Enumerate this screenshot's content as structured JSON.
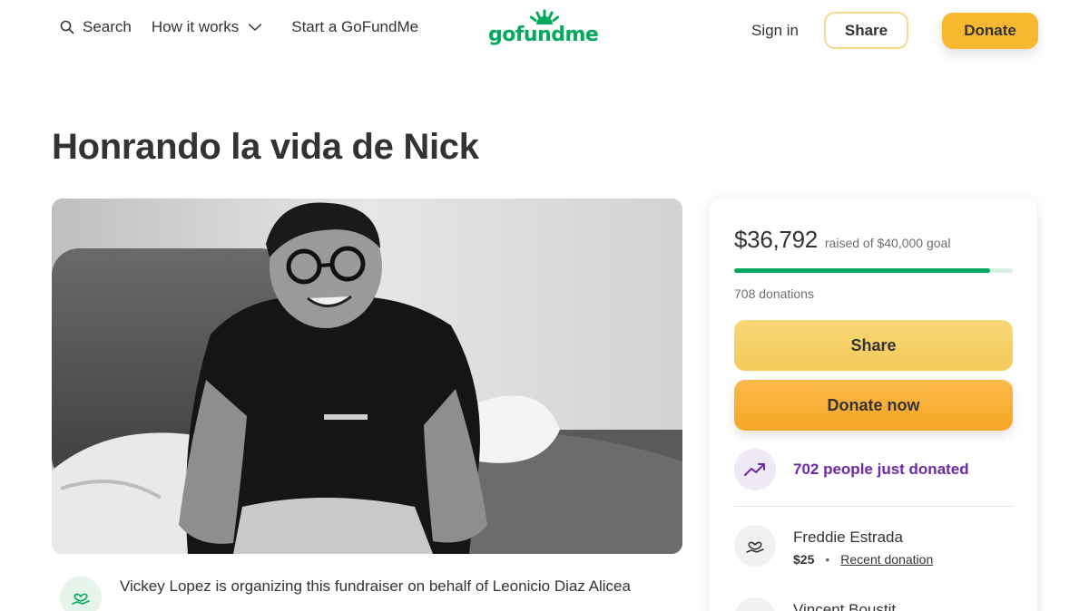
{
  "header": {
    "search_label": "Search",
    "how_it_works_label": "How it works",
    "start_label": "Start a GoFundMe",
    "logo_text": "gofundme",
    "sign_in_label": "Sign in",
    "share_label": "Share",
    "donate_label": "Donate"
  },
  "page": {
    "title": "Honrando la vida de Nick"
  },
  "organizer": {
    "text": "Vickey Lopez is organizing this fundraiser on behalf of Leonicio Diaz Alicea"
  },
  "panel": {
    "raised_amount": "$36,792",
    "raised_goal": "raised of $40,000 goal",
    "progress_fraction": 0.92,
    "donations_count": "708 donations",
    "share_label": "Share",
    "donate_now_label": "Donate now",
    "trend_text": "702 people just donated",
    "donors": [
      {
        "name": "Freddie Estrada",
        "amount": "$25",
        "tag": "Recent donation"
      },
      {
        "name": "Vincent Boustit"
      }
    ]
  },
  "colors": {
    "brand_green": "#02a95c",
    "donate_yellow": "#f8b832",
    "trend_purple": "#6b2aa8"
  },
  "icons": {
    "search": "search-icon",
    "dropdown": "chevron-down-icon",
    "trend": "trending-up-icon",
    "heart_hand": "heart-hand-icon"
  }
}
